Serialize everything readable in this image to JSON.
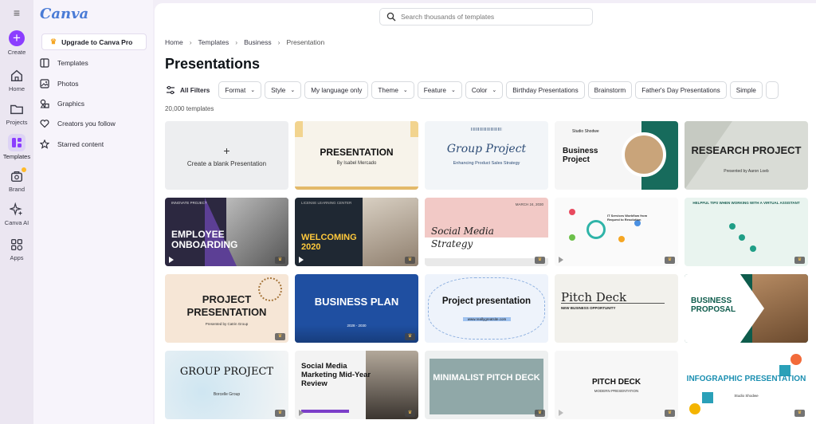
{
  "rail": {
    "items": [
      {
        "label": "Create",
        "icon": "plus-icon"
      },
      {
        "label": "Home",
        "icon": "home-icon"
      },
      {
        "label": "Projects",
        "icon": "folder-icon"
      },
      {
        "label": "Templates",
        "icon": "templates-icon"
      },
      {
        "label": "Brand",
        "icon": "brand-icon"
      },
      {
        "label": "Canva AI",
        "icon": "sparkle-icon"
      },
      {
        "label": "Apps",
        "icon": "apps-icon"
      }
    ]
  },
  "panel": {
    "logo": "Canva",
    "upgrade_label": "Upgrade to Canva Pro",
    "nav": [
      {
        "label": "Templates",
        "icon": "template-icon"
      },
      {
        "label": "Photos",
        "icon": "photo-icon"
      },
      {
        "label": "Graphics",
        "icon": "graphics-icon"
      },
      {
        "label": "Creators you follow",
        "icon": "heart-icon"
      },
      {
        "label": "Starred content",
        "icon": "star-icon"
      }
    ]
  },
  "search": {
    "placeholder": "Search thousands of templates"
  },
  "breadcrumb": [
    "Home",
    "Templates",
    "Business",
    "Presentation"
  ],
  "page_title": "Presentations",
  "filters": {
    "all_label": "All Filters",
    "dropdowns": [
      "Format",
      "Style"
    ],
    "language": "My language only",
    "dropdowns2": [
      "Theme",
      "Feature",
      "Color"
    ],
    "tags": [
      "Birthday Presentations",
      "Brainstorm",
      "Father's Day Presentations",
      "Simple"
    ]
  },
  "template_count": "20,000 templates",
  "blank_card_label": "Create a blank Presentation",
  "cards": [
    {
      "title": "PRESENTATION",
      "subtitle": "By Isabel Mercado"
    },
    {
      "title": "Group Project",
      "subtitle": "Enhancing Product Sales Strategy"
    },
    {
      "title": "Business Project",
      "subtitle": "Studio Shodwe"
    },
    {
      "title": "RESEARCH PROJECT",
      "subtitle": "Presented by Aaron Loeb"
    },
    {
      "title": "EMPLOYEE ONBOARDING",
      "subtitle": "INNOVATE PROJECT"
    },
    {
      "title": "WELCOMING 2020",
      "subtitle": "LICENSE LEARNING CENTER"
    },
    {
      "title": "Social Media Strategy",
      "subtitle": "MARCH 24, 2030"
    },
    {
      "title": "IT Services Workflow from Request to Resolution",
      "subtitle": ""
    },
    {
      "title": "HELPFUL TIPS WHEN WORKING WITH A VIRTUAL ASSISTANT",
      "subtitle": ""
    },
    {
      "title": "PROJECT PRESENTATION",
      "subtitle": "Presented by Catrin Group"
    },
    {
      "title": "BUSINESS PLAN",
      "subtitle": "2028 - 2030"
    },
    {
      "title": "Project presentation",
      "subtitle": "www.reallygreatsite.com"
    },
    {
      "title": "Pitch Deck",
      "subtitle": "NEW BUSINESS OPPORTUNITY"
    },
    {
      "title": "BUSINESS PROPOSAL",
      "subtitle": ""
    },
    {
      "title": "GROUP PROJECT",
      "subtitle": "Borcelle Group"
    },
    {
      "title": "Social Media Marketing Mid-Year Review",
      "subtitle": ""
    },
    {
      "title": "MINIMALIST PITCH DECK",
      "subtitle": ""
    },
    {
      "title": "PITCH DECK",
      "subtitle": "MODERN PRESENTATION"
    },
    {
      "title": "INFOGRAPHIC PRESENTATION",
      "subtitle": "Studio Shodwe"
    }
  ],
  "colors": {
    "accent": "#8b3dff",
    "crown": "#ffba29"
  }
}
